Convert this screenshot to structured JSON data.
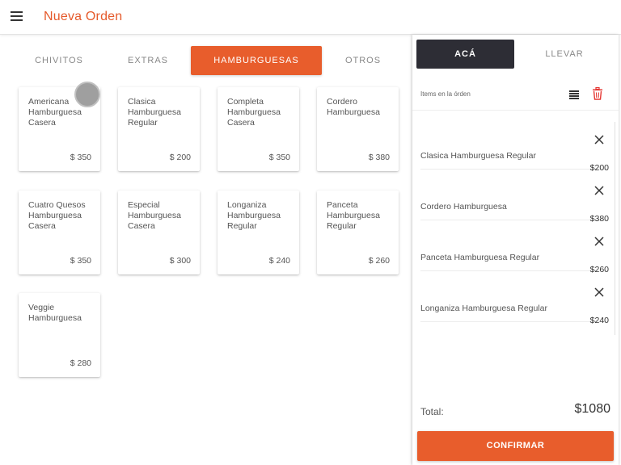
{
  "appbar": {
    "title": "Nueva Orden",
    "menu_icon": "menu-icon"
  },
  "tabs": [
    {
      "label": "CHIVITOS"
    },
    {
      "label": "EXTRAS"
    },
    {
      "label": "HAMBURGUESAS",
      "active": true
    },
    {
      "label": "OTROS"
    }
  ],
  "products": [
    {
      "name": "Americana Hamburguesa Casera",
      "price": "$ 350"
    },
    {
      "name": "Clasica Hamburguesa Regular",
      "price": "$ 200"
    },
    {
      "name": "Completa Hamburguesa Casera",
      "price": "$ 350"
    },
    {
      "name": "Cordero Hamburguesa",
      "price": "$ 380"
    },
    {
      "name": "Cuatro Quesos Hamburguesa Casera",
      "price": "$ 350"
    },
    {
      "name": "Especial Hamburguesa Casera",
      "price": "$ 300"
    },
    {
      "name": "Longaniza Hamburguesa Regular",
      "price": "$ 240"
    },
    {
      "name": "Panceta Hamburguesa Regular",
      "price": "$ 260"
    },
    {
      "name": "Veggie Hamburguesa",
      "price": "$ 280"
    }
  ],
  "panel": {
    "tab_here": "ACÁ",
    "tab_takeaway": "LLEVAR",
    "items_label": "Items en la órden",
    "order_items": [
      {
        "name": "Clasica Hamburguesa Regular",
        "price": "$200"
      },
      {
        "name": "Cordero Hamburguesa",
        "price": "$380"
      },
      {
        "name": "Panceta Hamburguesa Regular",
        "price": "$260"
      },
      {
        "name": "Longaniza Hamburguesa Regular",
        "price": "$240"
      }
    ],
    "total_label": "Total:",
    "total_value": "$1080",
    "confirm_label": "CONFIRMAR"
  },
  "colors": {
    "accent": "#e85d2c",
    "dark": "#2d2d35",
    "delete": "#e53935"
  }
}
